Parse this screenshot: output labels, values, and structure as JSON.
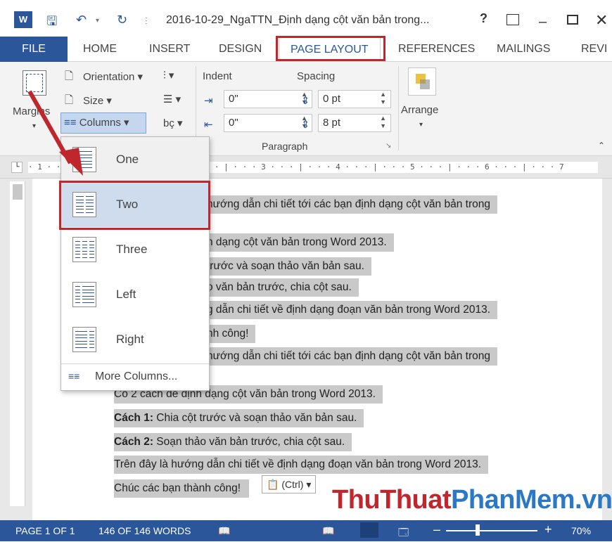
{
  "window": {
    "title": "2016-10-29_NgaTTN_Định dạng cột văn bản trong...",
    "help": "?",
    "controls": [
      "ribbon-options",
      "minimize",
      "maximize",
      "close"
    ]
  },
  "tabs": [
    {
      "label": "FILE"
    },
    {
      "label": "HOME"
    },
    {
      "label": "INSERT"
    },
    {
      "label": "DESIGN"
    },
    {
      "label": "PAGE LAYOUT"
    },
    {
      "label": "REFERENCES"
    },
    {
      "label": "MAILINGS"
    },
    {
      "label": "REVI"
    }
  ],
  "ribbon": {
    "margins": "Margins",
    "orientation": "Orientation",
    "size": "Size",
    "columns": "Columns",
    "indent_label": "Indent",
    "spacing_label": "Spacing",
    "indent_left": "0\"",
    "indent_right": "0\"",
    "spacing_before": "0 pt",
    "spacing_after": "8 pt",
    "paragraph_group": "Paragraph",
    "arrange": "Arrange"
  },
  "ruler_text": "· 1 · · · | · · · 1 · · · | · · · 2 · · · | · · · 3 · · · | · · · 4 · · · | · · · 5 · · · | · · · 6 · · · | · · · 7",
  "columns_menu": {
    "items": [
      "One",
      "Two",
      "Three",
      "Left",
      "Right"
    ],
    "more": "More Columns..."
  },
  "document": {
    "lines_partial": [
      "hướng dẫn chi tiết tới các bạn định dạng cột văn bản trong",
      "n dạng cột văn bản trong Word 2013.",
      "trước và soạn thảo văn bản sau.",
      "o văn bản trước, chia cột sau.",
      "g dẫn chi tiết về định dạng đoạn văn bản trong Word 2013.",
      "nh công!",
      "hướng dẫn chi tiết tới các bạn định dạng cột văn bản trong"
    ],
    "line1": "Có 2 cách để định dạng cột văn bản trong Word 2013.",
    "line2_bold": "Cách 1:",
    "line2_rest": " Chia cột trước và soạn thảo văn bản sau.",
    "line3_bold": "Cách 2:",
    "line3_rest": " Soạn thảo văn bản trước, chia cột sau.",
    "line4": "Trên đây là hướng dẫn chi tiết về định dạng đoạn văn bản trong Word 2013.",
    "line5": "Chúc các bạn thành công!",
    "paste_options": "(Ctrl)"
  },
  "watermark": {
    "part1": "ThuThuat",
    "part2": "PhanMem",
    "part3": ".vn",
    "color1": "#c0272d",
    "color2": "#2b78c5"
  },
  "status": {
    "page": "PAGE 1 OF 1",
    "words": "146 OF 146 WORDS",
    "zoom": "70%"
  },
  "colors": {
    "accent": "#2b579a",
    "highlight_box": "#c0272d",
    "selection": "#c9c9c9"
  }
}
